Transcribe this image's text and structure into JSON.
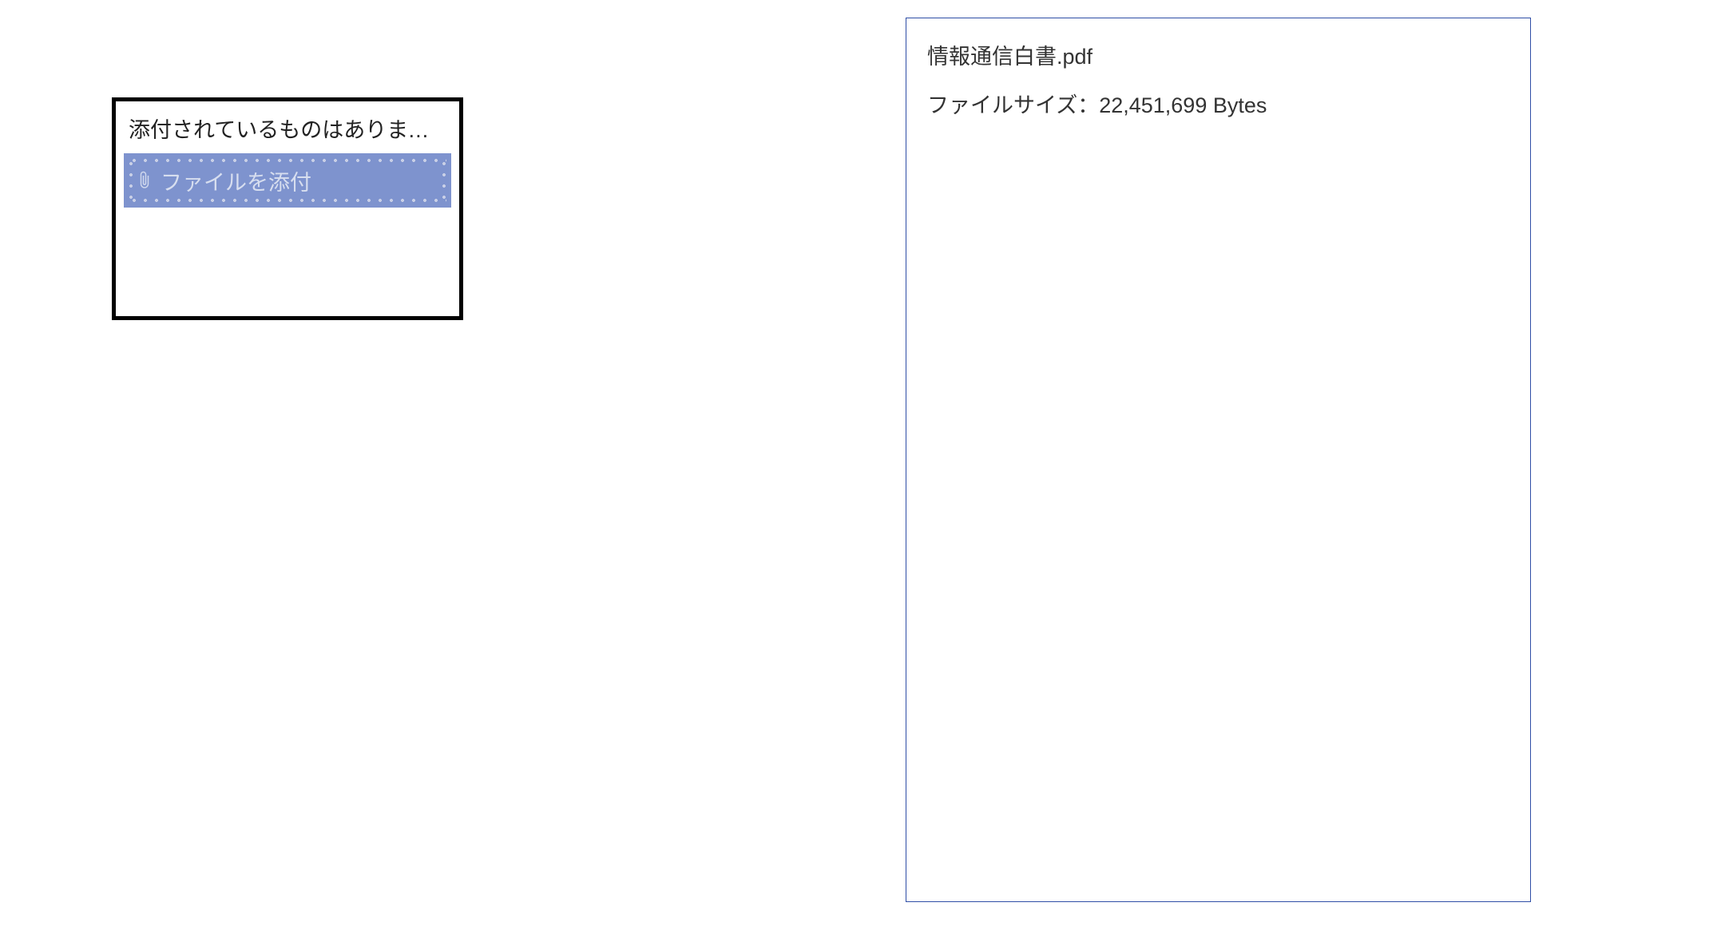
{
  "attach_panel": {
    "header_text": "添付されているものはありませ...",
    "button_label": "ファイルを添付"
  },
  "details_panel": {
    "file_name": "情報通信白書.pdf",
    "file_size_label": "ファイルサイズ：",
    "file_size_value": "22,451,699 Bytes"
  }
}
